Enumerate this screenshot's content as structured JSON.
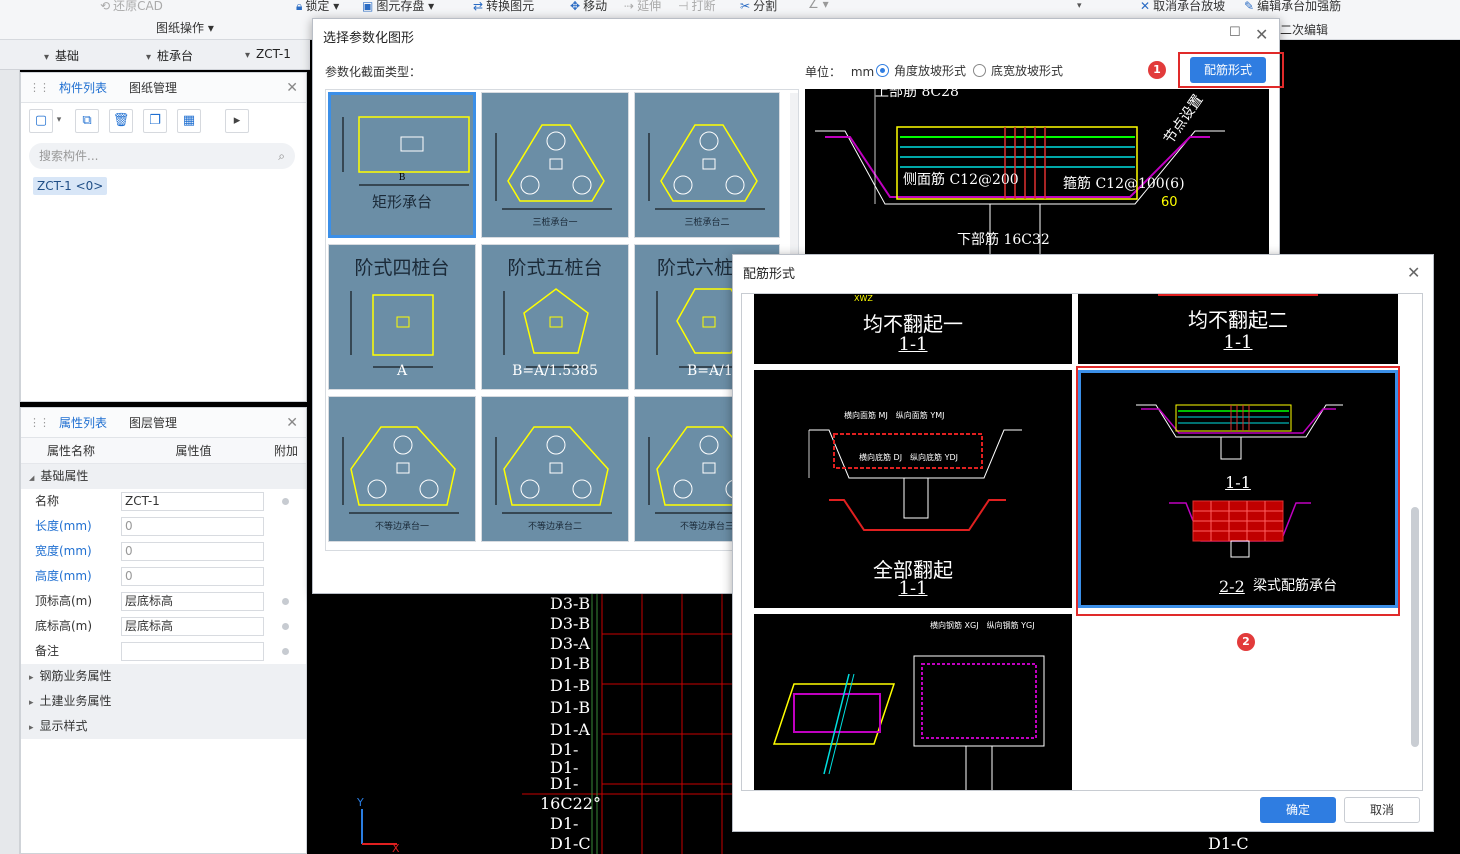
{
  "ribbon": {
    "restore_cad": "还原CAD",
    "drawing_ops": "图纸操作",
    "lock": "锁定",
    "elem_save": "图元存盘",
    "convert": "转换图元",
    "move": "移动",
    "extend": "延伸",
    "break": "打断",
    "split": "分割",
    "cancel_cap": "取消承台放坡",
    "edit_cap_rebar": "编辑承台加强筋",
    "second_edit": "二次编辑"
  },
  "selectors": {
    "category": "基础",
    "type": "桩承台",
    "item": "ZCT-1"
  },
  "component_panel": {
    "tab_active": "构件列表",
    "tab_other": "图纸管理",
    "search_placeholder": "搜索构件...",
    "selected_item": "ZCT-1 <0>"
  },
  "property_panel": {
    "tab_active": "属性列表",
    "tab_other": "图层管理",
    "col_name": "属性名称",
    "col_value": "属性值",
    "col_extra": "附加",
    "group_basic": "基础属性",
    "rows": [
      {
        "name": "名称",
        "value": "ZCT-1"
      },
      {
        "name": "长度(mm)",
        "value": "0"
      },
      {
        "name": "宽度(mm)",
        "value": "0"
      },
      {
        "name": "高度(mm)",
        "value": "0"
      },
      {
        "name": "顶标高(m)",
        "value": "层底标高"
      },
      {
        "name": "底标高(m)",
        "value": "层底标高"
      },
      {
        "name": "备注",
        "value": ""
      }
    ],
    "groups": [
      "钢筋业务属性",
      "土建业务属性",
      "显示样式"
    ]
  },
  "param_dialog": {
    "title": "选择参数化图形",
    "section_label": "参数化截面类型：",
    "unit_label": "单位：",
    "unit": "mm",
    "radio_angle": "角度放坡形式",
    "radio_width": "底宽放坡形式",
    "rebar_button": "配筋形式",
    "badge1": "1",
    "thumbs": [
      {
        "label": "矩形承台",
        "sub": "B"
      },
      {
        "label": "三桩承台一"
      },
      {
        "label": "三桩承台二"
      },
      {
        "label": "阶式四桩台",
        "sub": "A"
      },
      {
        "label": "阶式五桩台",
        "sub": "B=A/1.5385"
      },
      {
        "label": "阶式六桩",
        "sub": "B=A/1."
      },
      {
        "label": "不等边承台一"
      },
      {
        "label": "不等边承台二"
      },
      {
        "label": "不等边承台三"
      }
    ],
    "preview": {
      "top": "上部筋 8C28",
      "side": "侧面筋 C12@200",
      "stirrup": "箍筋 C12@100(6)",
      "bottom": "下部筋 16C32",
      "node": "节点设置",
      "angle": "60"
    }
  },
  "rebar_dialog": {
    "title": "配筋形式",
    "badge2": "2",
    "ok": "确定",
    "cancel": "取消",
    "options": [
      {
        "title": "均不翻起一",
        "sub": "1-1"
      },
      {
        "title": "均不翻起二",
        "sub": "1-1"
      },
      {
        "title": "全部翻起",
        "sub": "1-1"
      },
      {
        "title": "梁式配筋承台",
        "sub": "1-1",
        "sub2": "2-2"
      },
      {
        "title": ""
      }
    ]
  },
  "canvas_labels": [
    "D3-B",
    "D3-B",
    "D3-A",
    "D1-B",
    "D1-B",
    "D1-B",
    "D1-A",
    "D1-",
    "D1-",
    "D1-",
    "16C22°",
    "D1-",
    "D1-C",
    "D1-C"
  ]
}
